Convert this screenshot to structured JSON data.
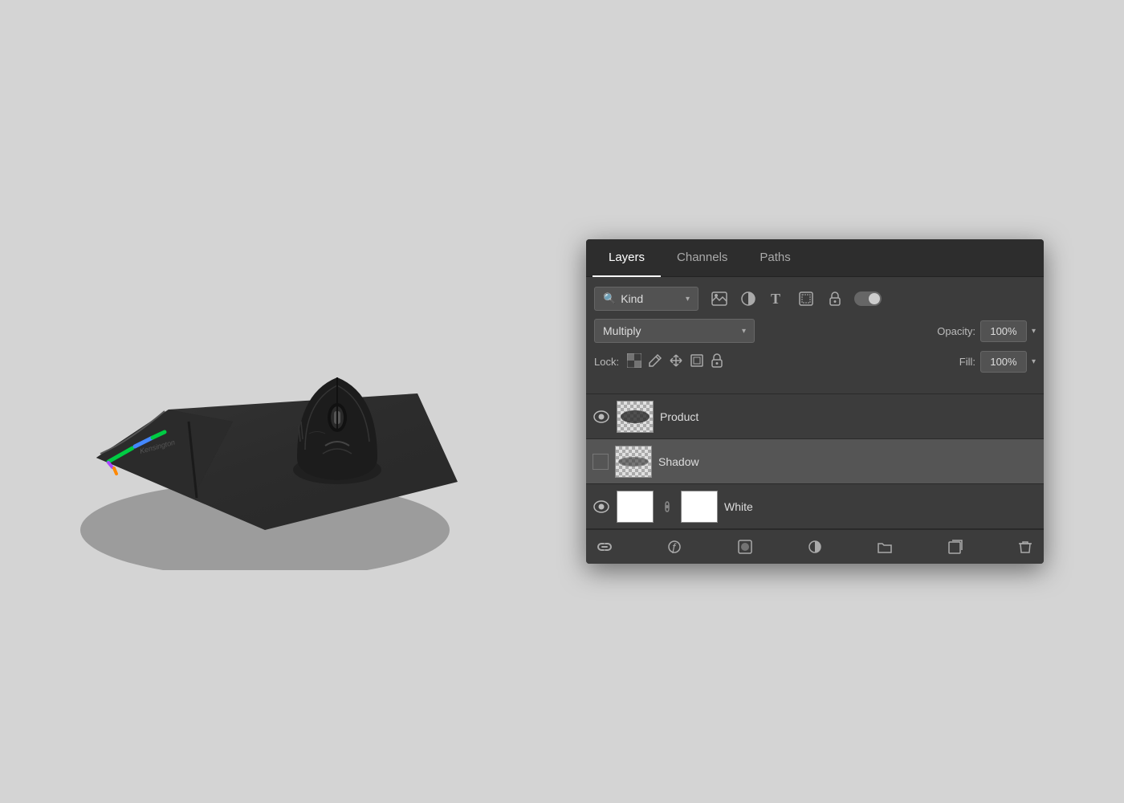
{
  "background_color": "#d4d4d4",
  "panel": {
    "tabs": [
      {
        "label": "Layers",
        "active": true
      },
      {
        "label": "Channels",
        "active": false
      },
      {
        "label": "Paths",
        "active": false
      }
    ],
    "filter": {
      "kind_label": "Kind",
      "icons": [
        "image-filter-icon",
        "circle-filter-icon",
        "text-filter-icon",
        "shape-filter-icon",
        "lock-filter-icon"
      ]
    },
    "blend_mode": {
      "value": "Multiply",
      "opacity_label": "Opacity:",
      "opacity_value": "100%"
    },
    "lock": {
      "label": "Lock:",
      "fill_label": "Fill:",
      "fill_value": "100%"
    },
    "layers": [
      {
        "name": "Product",
        "visible": true,
        "selected": false,
        "has_link": false,
        "thumb_type": "checker-product"
      },
      {
        "name": "Shadow",
        "visible": false,
        "selected": true,
        "has_link": false,
        "thumb_type": "checker-shadow"
      },
      {
        "name": "White",
        "visible": true,
        "selected": false,
        "has_link": true,
        "thumb_type": "white"
      }
    ]
  }
}
